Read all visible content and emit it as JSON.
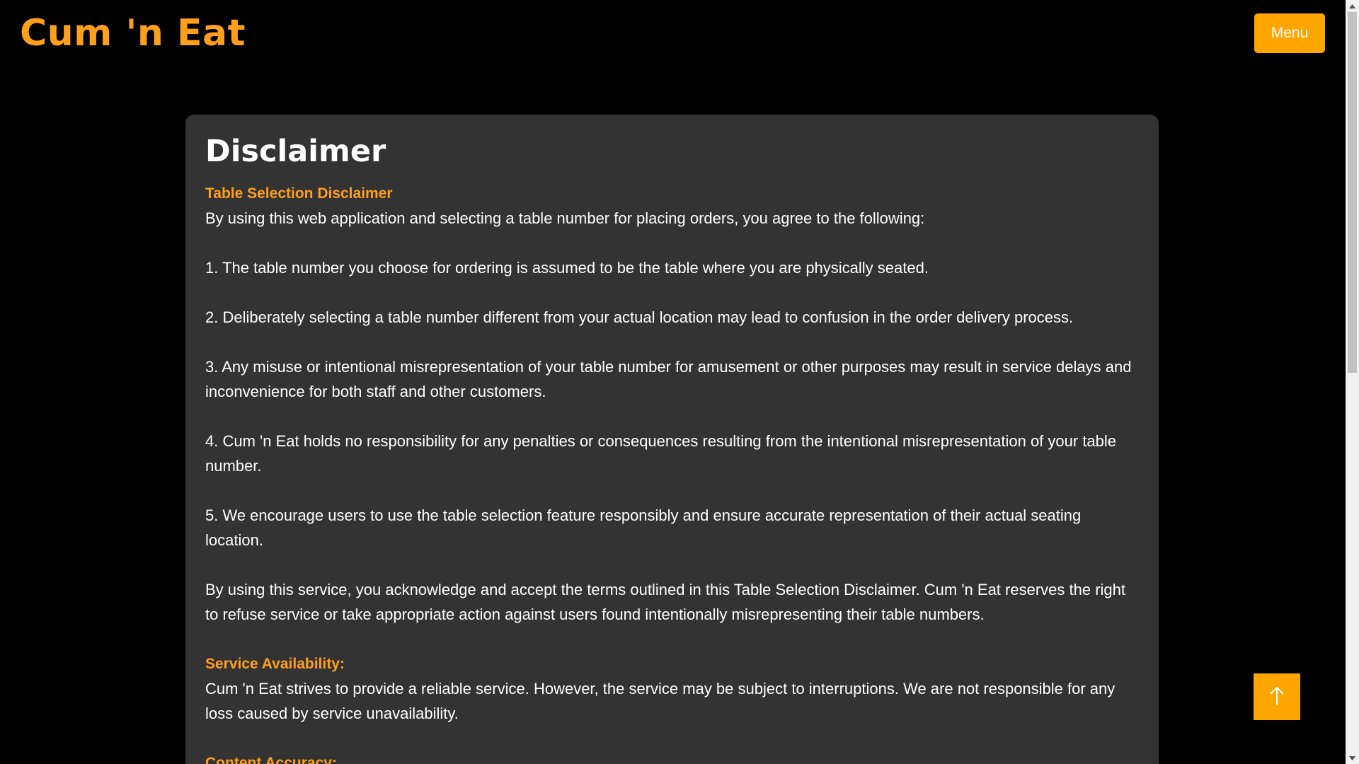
{
  "header": {
    "brand": "Cum 'n Eat",
    "menu_label": "Menu"
  },
  "main": {
    "title": "Disclaimer",
    "sections": [
      {
        "heading": "Table Selection Disclaimer",
        "intro": "By using this web application and selecting a table number for placing orders, you agree to the following:",
        "items": [
          "1. The table number you choose for ordering is assumed to be the table where you are physically seated.",
          "2. Deliberately selecting a table number different from your actual location may lead to confusion in the order delivery process.",
          "3. Any misuse or intentional misrepresentation of your table number for amusement or other purposes may result in service delays and inconvenience for both staff and other customers.",
          "4. Cum 'n Eat holds no responsibility for any penalties or consequences resulting from the intentional misrepresentation of your table number.",
          "5. We encourage users to use the table selection feature responsibly and ensure accurate representation of their actual seating location."
        ],
        "closing": "By using this service, you acknowledge and accept the terms outlined in this Table Selection Disclaimer. Cum 'n Eat reserves the right to refuse service or take appropriate action against users found intentionally misrepresenting their table numbers."
      },
      {
        "heading": "Service Availability:",
        "body": "Cum 'n Eat strives to provide a reliable service. However, the service may be subject to interruptions. We are not responsible for any loss caused by service unavailability."
      },
      {
        "heading": "Content Accuracy:"
      }
    ]
  },
  "scroll_top": {
    "icon": "arrow-up-icon"
  },
  "colors": {
    "background": "#000000",
    "card": "#333333",
    "accent": "#FF9F1C",
    "button": "#FFA500",
    "text": "#FFFFFF"
  }
}
